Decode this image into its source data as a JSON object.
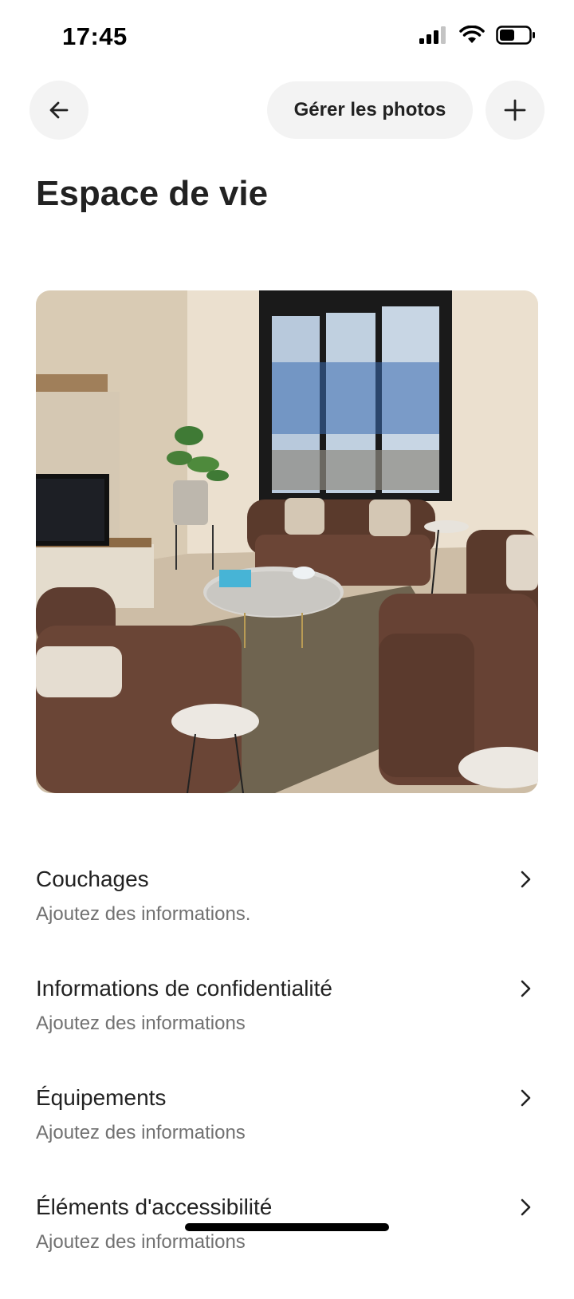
{
  "status_bar": {
    "time": "17:45",
    "icons": [
      "cellular-signal-icon",
      "wifi-icon",
      "battery-icon"
    ]
  },
  "header": {
    "back_icon": "arrow-left-icon",
    "manage_photos_label": "Gérer les photos",
    "add_icon": "plus-icon"
  },
  "page": {
    "title": "Espace de vie"
  },
  "photo": {
    "subject": "living-room-photo"
  },
  "rows": [
    {
      "title": "Couchages",
      "subtitle": "Ajoutez des informations."
    },
    {
      "title": "Informations de confidentialité",
      "subtitle": "Ajoutez des informations"
    },
    {
      "title": "Équipements",
      "subtitle": "Ajoutez des informations"
    },
    {
      "title": "Éléments d'accessibilité",
      "subtitle": "Ajoutez des informations"
    }
  ],
  "colors": {
    "text_primary": "#222222",
    "text_secondary": "#717171",
    "button_bg": "#f3f3f3",
    "background": "#ffffff"
  }
}
